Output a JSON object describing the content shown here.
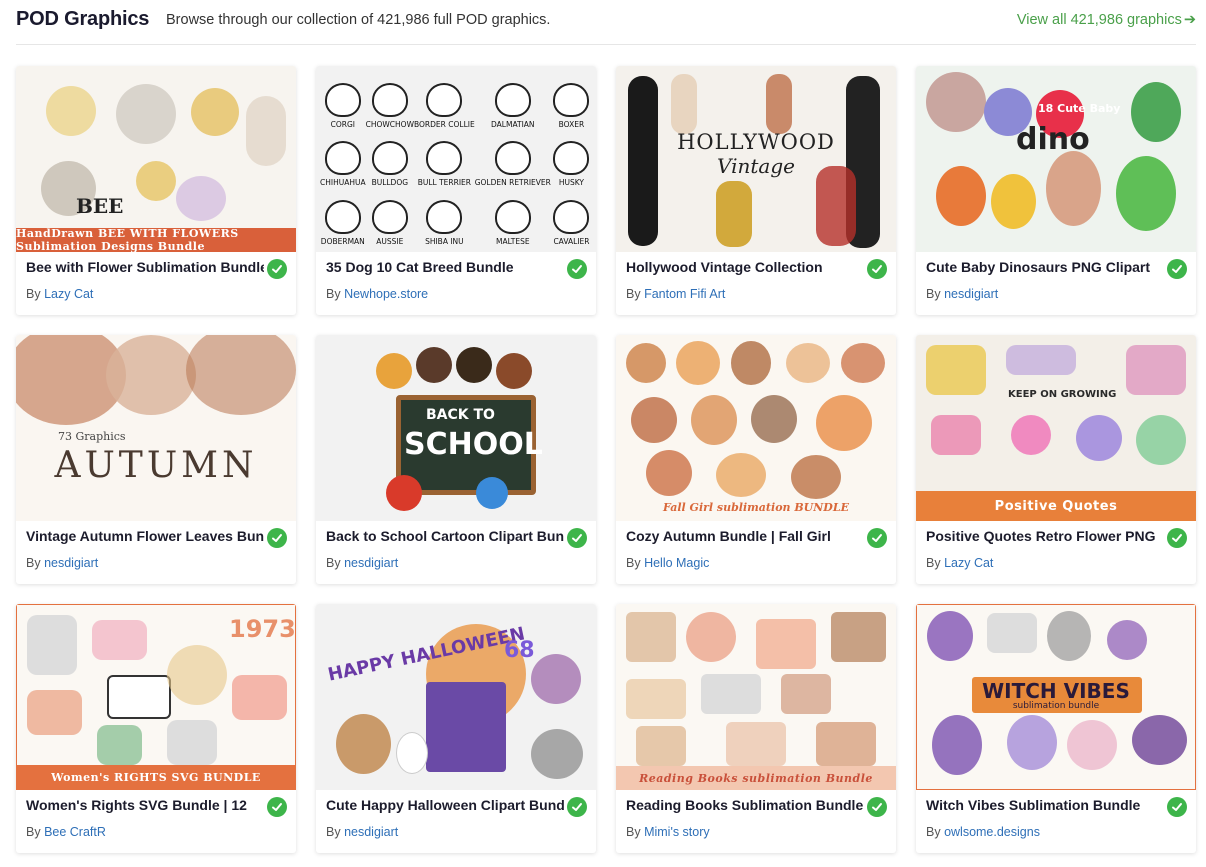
{
  "header": {
    "title": "POD Graphics",
    "subtitle": "Browse through our collection of 421,986 full POD graphics.",
    "view_all": "View all 421,986 graphics",
    "view_all_icon": "arrow-right-icon"
  },
  "colors": {
    "accent_green": "#4aa04a",
    "check_green": "#3db54a",
    "author_link": "#2e6fb7"
  },
  "author_prefix": "By ",
  "cards": [
    {
      "title": "Bee with Flower Sublimation Bundle",
      "author": "Lazy Cat",
      "thumb_text": "BEE",
      "banner": "HandDrawn BEE WITH FLOWERS Sublimation Designs Bundle"
    },
    {
      "title": "35 Dog 10 Cat Breed Bundle",
      "author": "Newhope.store",
      "thumb_labels": [
        "CORGI",
        "CHOWCHOW",
        "BORDER COLLIE",
        "DALMATIAN",
        "BOXER",
        "CHIHUAHUA",
        "BULLDOG",
        "BULL TERRIER",
        "GOLDEN RETRIEVER",
        "HUSKY",
        "DOBERMAN",
        "AUSSIE",
        "SHIBA INU",
        "MALTESE",
        "CAVALIER"
      ]
    },
    {
      "title": "Hollywood Vintage Collection",
      "author": "Fantom Fifi Art",
      "thumb_text": "HOLLYWOOD",
      "thumb_text2": "Vintage"
    },
    {
      "title": "Cute Baby Dinosaurs PNG Clipart",
      "author": "nesdigiart",
      "thumb_text": "dino",
      "thumb_text2": "18 Cute Baby"
    },
    {
      "title": "Vintage Autumn Flower Leaves Bundle",
      "author": "nesdigiart",
      "thumb_text": "AUTUMN",
      "thumb_text2": "73 Graphics"
    },
    {
      "title": "Back to School Cartoon Clipart Bundle",
      "author": "nesdigiart",
      "thumb_text": "SCHOOL",
      "thumb_text2": "BACK TO"
    },
    {
      "title": "Cozy Autumn Bundle | Fall Girl",
      "author": "Hello Magic",
      "thumb_text": "Fall Girl sublimation BUNDLE"
    },
    {
      "title": "Positive Quotes Retro Flower PNG",
      "author": "Lazy Cat",
      "thumb_text": "Positive Quotes",
      "thumb_text2": "KEEP ON GROWING"
    },
    {
      "title": "Women's Rights SVG Bundle | 12",
      "author": "Bee CraftR",
      "thumb_text": "Women's RIGHTS SVG BUNDLE",
      "thumb_text2": "1973"
    },
    {
      "title": "Cute Happy Halloween Clipart Bundle",
      "author": "nesdigiart",
      "thumb_text": "HAPPY HALLOWEEN",
      "thumb_text2": "68"
    },
    {
      "title": "Reading Books Sublimation Bundle",
      "author": "Mimi's story",
      "thumb_text": "Reading Books sublimation Bundle"
    },
    {
      "title": "Witch Vibes Sublimation Bundle",
      "author": "owlsome.designs",
      "thumb_text": "WITCH VIBES",
      "thumb_text2": "sublimation bundle"
    }
  ]
}
